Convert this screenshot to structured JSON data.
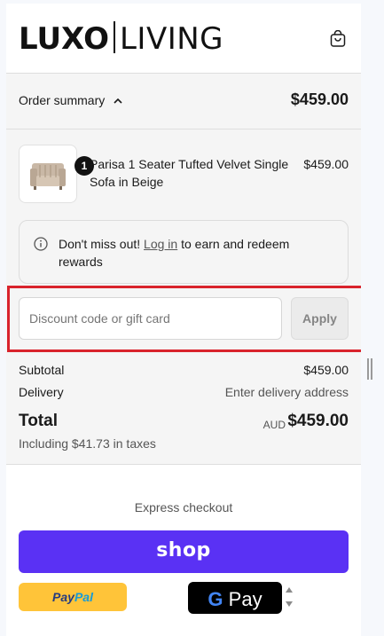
{
  "header": {
    "logo_left": "LUXO",
    "logo_right": "LIVING"
  },
  "summary": {
    "label": "Order summary",
    "total": "$459.00"
  },
  "product": {
    "quantity": "1",
    "name": "Parisa 1 Seater Tufted Velvet Single Sofa in Beige",
    "price": "$459.00"
  },
  "notice": {
    "before": "Don't miss out! ",
    "link": "Log in",
    "after": " to earn and redeem rewards"
  },
  "discount": {
    "placeholder": "Discount code or gift card",
    "apply_label": "Apply"
  },
  "totals": {
    "subtotal_label": "Subtotal",
    "subtotal_value": "$459.00",
    "delivery_label": "Delivery",
    "delivery_value": "Enter delivery address",
    "total_label": "Total",
    "currency": "AUD",
    "total_value": "$459.00",
    "taxes": "Including $41.73 in taxes"
  },
  "express": {
    "label": "Express checkout",
    "shop_label": "shop",
    "paypal_left": "Pay",
    "paypal_right": "Pal",
    "gpay_g": "G",
    "gpay_label": "Pay"
  },
  "colors": {
    "shop": "#5a31f4",
    "paypal": "#ffc439",
    "highlight": "#d9232c"
  }
}
